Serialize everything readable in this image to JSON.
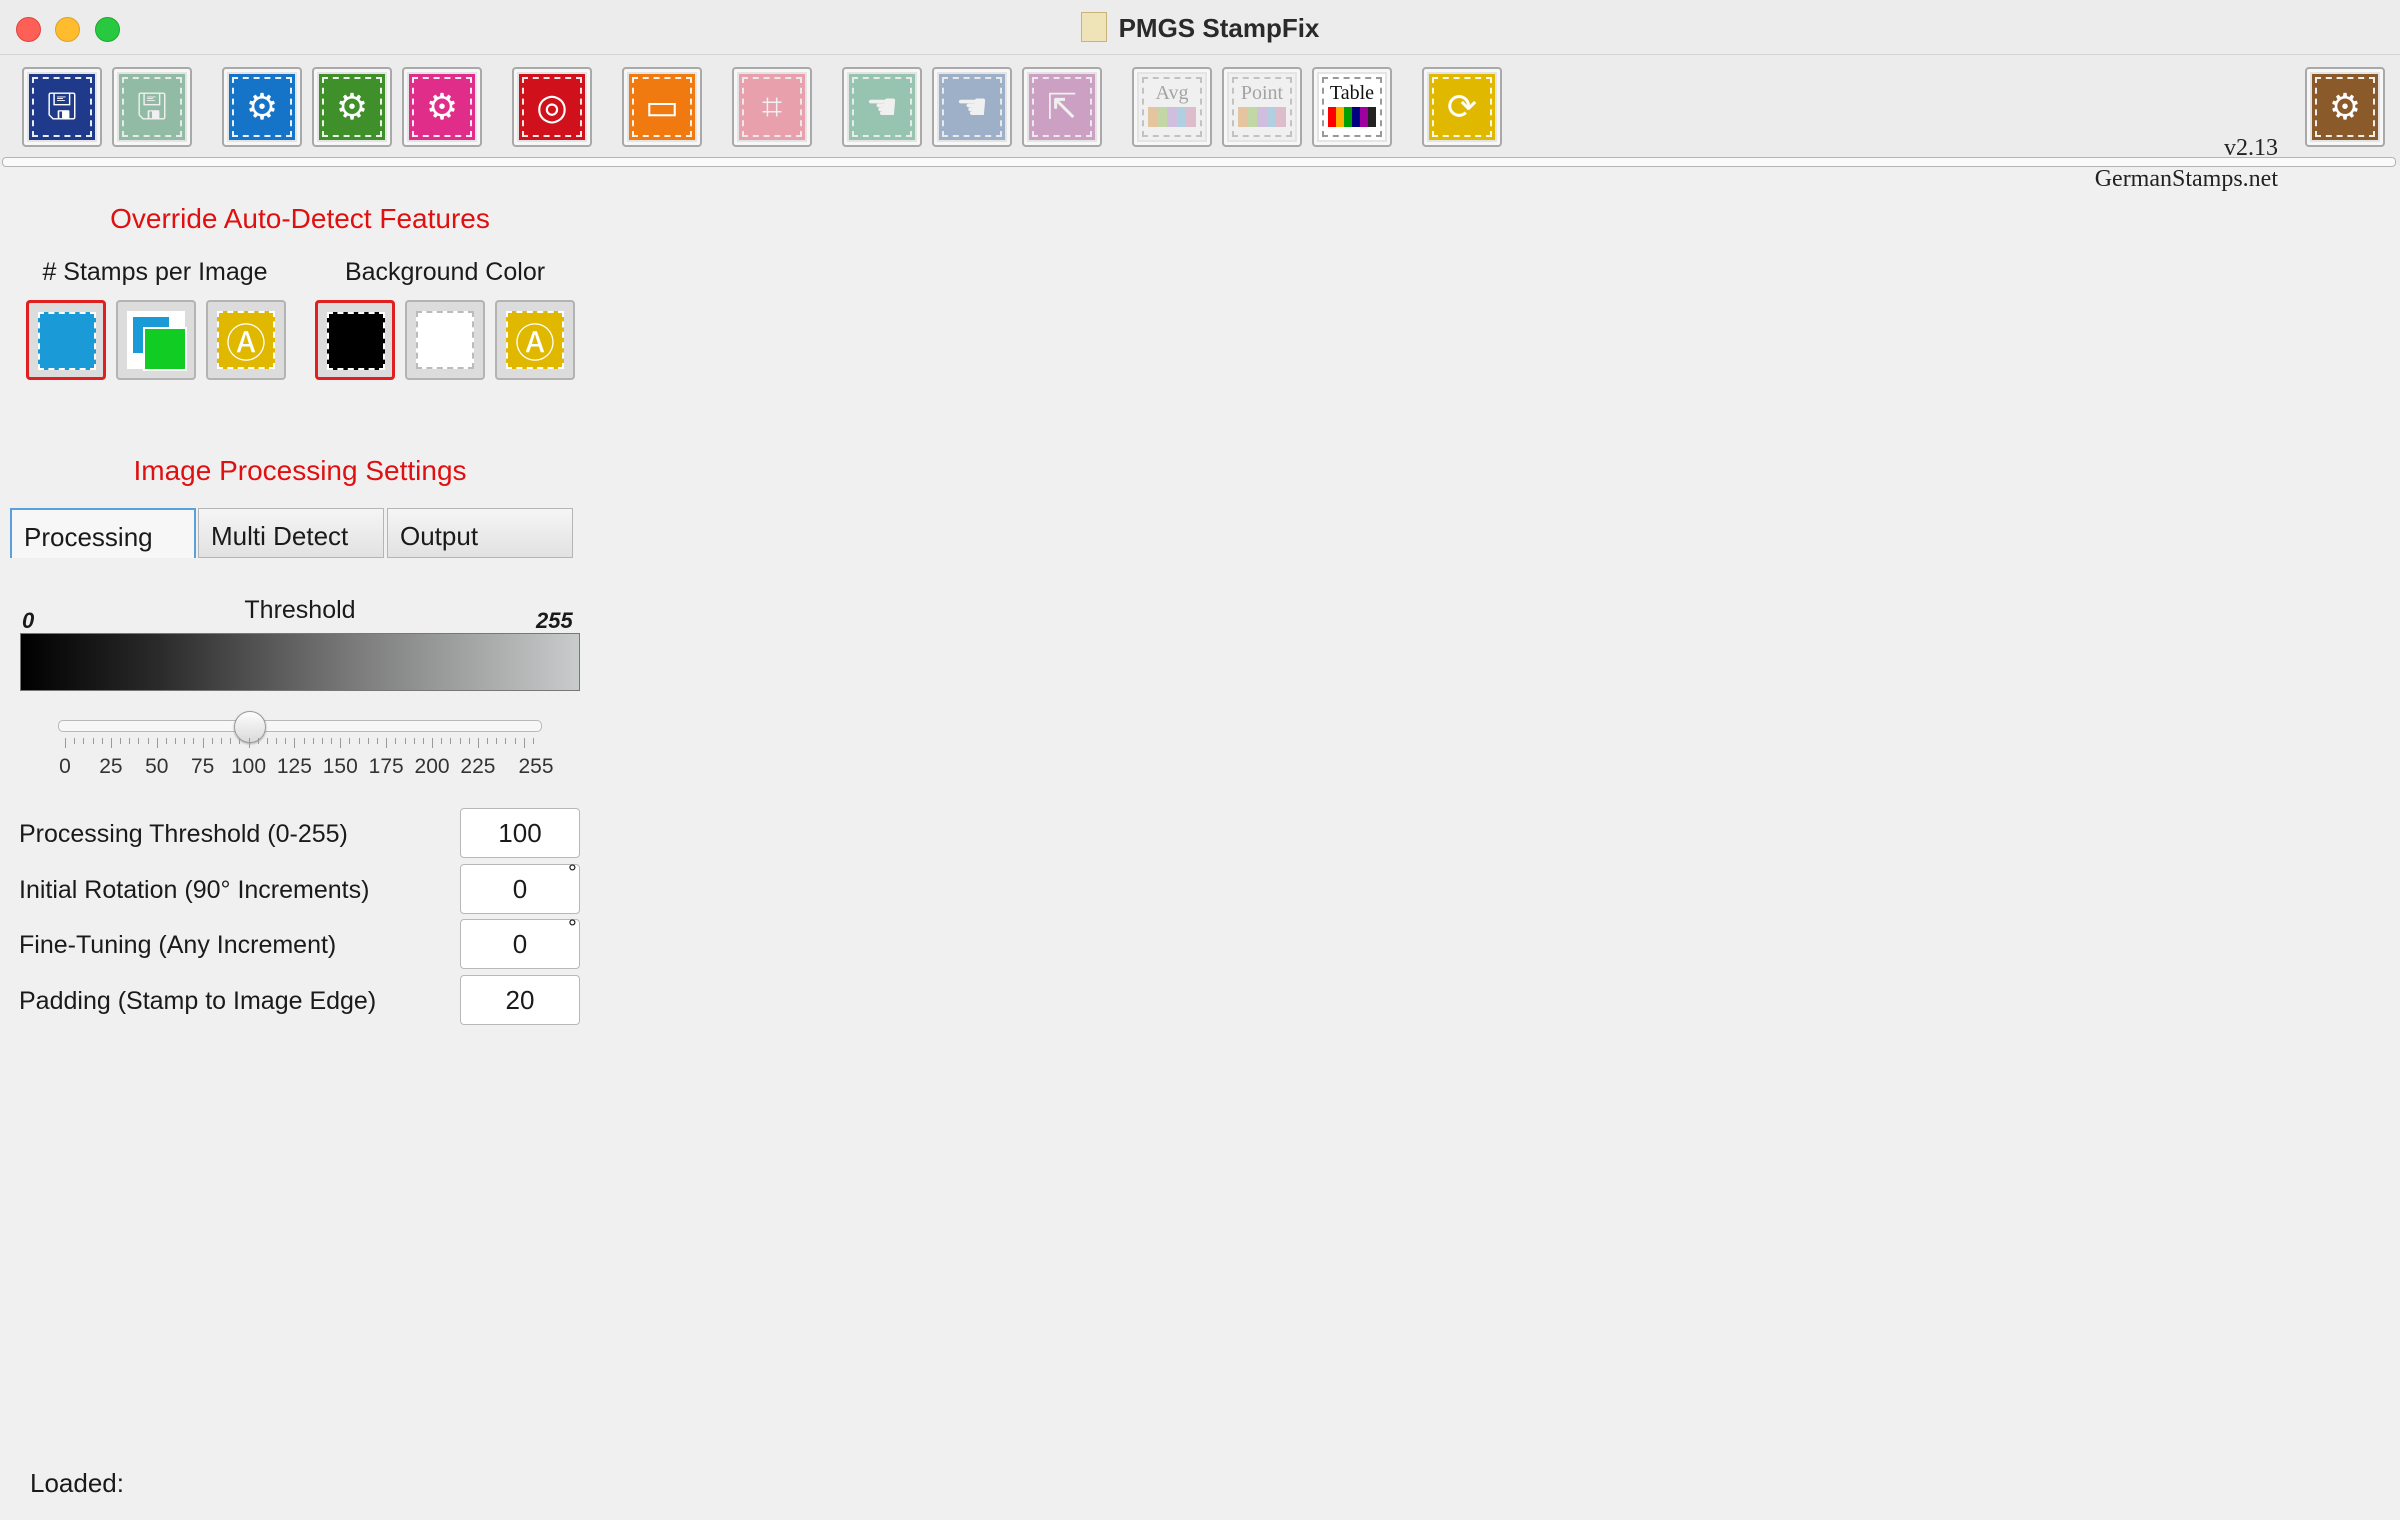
{
  "window": {
    "title": "PMGS StampFix"
  },
  "toolbar": {
    "version": "v2.13",
    "site": "GermanStamps.net",
    "buttons": [
      {
        "name": "open-file-button",
        "color": "#1f3a8a",
        "glyph": "🖫",
        "faded": false
      },
      {
        "name": "save-file-button",
        "color": "#2e8b57",
        "glyph": "🖫",
        "faded": true
      },
      {
        "name": "process-upload-button",
        "color": "#1573c8",
        "glyph": "⚙",
        "faded": false
      },
      {
        "name": "process-download-button",
        "color": "#3f8f2a",
        "glyph": "⚙",
        "faded": false
      },
      {
        "name": "process-cycle-button",
        "color": "#e02d8a",
        "glyph": "⚙",
        "faded": false
      },
      {
        "name": "target-button",
        "color": "#d0101a",
        "glyph": "◎",
        "faded": false
      },
      {
        "name": "display-button",
        "color": "#f07a10",
        "glyph": "▭",
        "faded": false
      },
      {
        "name": "crop-button",
        "color": "#ef4e6a",
        "glyph": "⌗",
        "faded": true
      },
      {
        "name": "pointer-remove-button",
        "color": "#3c9f72",
        "glyph": "☚",
        "faded": true
      },
      {
        "name": "pointer-add-button",
        "color": "#4a72a8",
        "glyph": "☚",
        "faded": true
      },
      {
        "name": "export-button",
        "color": "#b04e9a",
        "glyph": "⇱",
        "faded": true
      },
      {
        "name": "refresh-button",
        "color": "#e0b800",
        "glyph": "⟳",
        "faded": false
      },
      {
        "name": "settings-button",
        "color": "#8b5a2b",
        "glyph": "⚙",
        "faded": false
      }
    ],
    "text_buttons": [
      {
        "name": "avg-color-button",
        "label": "Avg",
        "faded": true
      },
      {
        "name": "point-color-button",
        "label": "Point",
        "faded": true
      },
      {
        "name": "table-color-button",
        "label": "Table",
        "faded": false
      }
    ]
  },
  "override": {
    "heading": "Override Auto-Detect Features",
    "stamps_label": "# Stamps per Image",
    "background_label": "Background Color",
    "stamps_options": [
      {
        "name": "single-stamp-option",
        "color": "#1a9bd8",
        "active": true
      },
      {
        "name": "multi-stamp-option",
        "color": "#11cc22",
        "active": false
      },
      {
        "name": "auto-stamp-option",
        "color": "#e0b800",
        "active": false,
        "glyph": "Ⓐ"
      }
    ],
    "background_options": [
      {
        "name": "black-background-option",
        "color": "#000000",
        "active": true
      },
      {
        "name": "white-background-option",
        "color": "#ffffff",
        "active": false
      },
      {
        "name": "auto-background-option",
        "color": "#e0b800",
        "active": false,
        "glyph": "Ⓐ"
      }
    ]
  },
  "processing": {
    "heading": "Image Processing Settings",
    "tabs": [
      "Processing",
      "Multi Detect",
      "Output"
    ],
    "active_tab": "Processing",
    "threshold": {
      "title": "Threshold",
      "min_label": "0",
      "max_label": "255",
      "slider_value": 100,
      "slider_max": 255,
      "ticks": [
        "0",
        "25",
        "50",
        "75",
        "100",
        "125",
        "150",
        "175",
        "200",
        "225",
        "255"
      ]
    },
    "fields": [
      {
        "label": "Processing Threshold (0-255)",
        "value": "100",
        "unit": ""
      },
      {
        "label": "Initial Rotation (90° Increments)",
        "value": "0",
        "unit": "°"
      },
      {
        "label": "Fine-Tuning (Any Increment)",
        "value": "0",
        "unit": "°"
      },
      {
        "label": "Padding (Stamp to Image Edge)",
        "value": "20",
        "unit": ""
      }
    ]
  },
  "status": {
    "loaded": "Loaded:"
  }
}
